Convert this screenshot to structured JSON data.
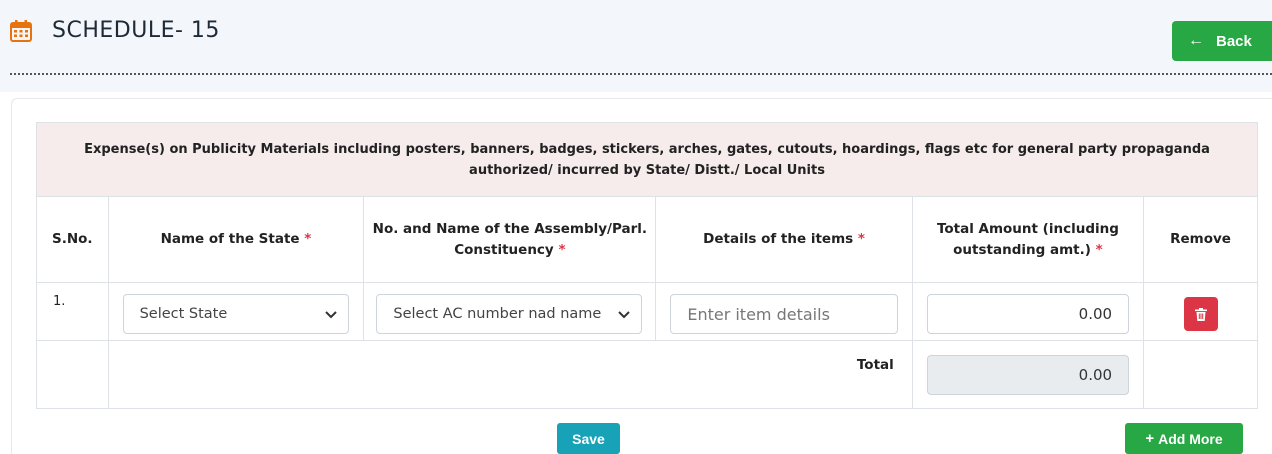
{
  "header": {
    "title": "SCHEDULE- 15",
    "back_label": "Back",
    "icons": {
      "title": "calendar-icon",
      "back": "arrow-left-icon"
    }
  },
  "table": {
    "caption": "Expense(s) on Publicity Materials including posters, banners, badges, stickers, arches, gates, cutouts, hoardings, flags etc for general party propaganda authorized/ incurred by State/ Distt./ Local Units",
    "columns": {
      "sno": "S.No.",
      "state": "Name of the State",
      "constituency": "No. and Name of the Assembly/Parl. Constituency",
      "items": "Details of the items",
      "amount": "Total Amount (including outstanding amt.)",
      "remove": "Remove"
    },
    "required_marker": "*",
    "rows": [
      {
        "sno": "1.",
        "state_selected": "Select State",
        "constituency_selected": "Select AC number nad name",
        "items_placeholder": "Enter item details",
        "amount": "0.00"
      }
    ],
    "total_label": "Total",
    "total_amount": "0.00"
  },
  "actions": {
    "save_label": "Save",
    "add_more_label": "Add More"
  },
  "colors": {
    "success": "#28a745",
    "danger": "#dc3545",
    "info": "#17a2b8",
    "calendar_icon": "#e8730c",
    "caption_bg": "#f6ecec"
  }
}
